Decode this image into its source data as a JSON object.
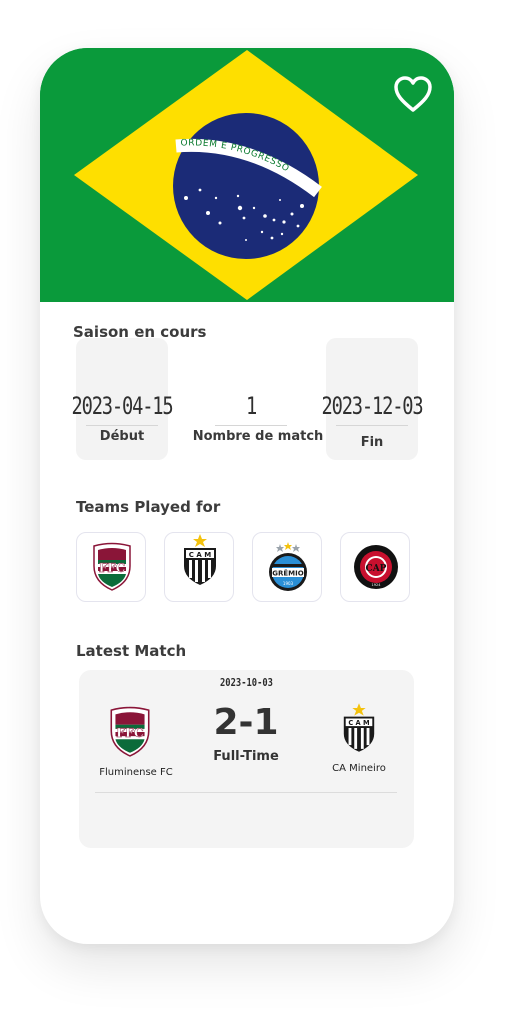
{
  "header": {
    "flag": {
      "motto": "ORDEM E PROGRESSO",
      "colors": {
        "green": "#0a9a3b",
        "yellow": "#fedf00",
        "blue": "#1b2b77",
        "white": "#ffffff"
      }
    },
    "favorite_icon": "heart-outline-icon"
  },
  "season": {
    "title": "Saison en cours",
    "start": {
      "value": "2023-04-15",
      "label": "Début"
    },
    "matches": {
      "value": "1",
      "label": "Nombre de match"
    },
    "end": {
      "value": "2023-12-03",
      "label": "Fin"
    }
  },
  "teams": {
    "title": "Teams Played for",
    "items": [
      {
        "icon": "fluminense-crest-icon",
        "letters": "FFC"
      },
      {
        "icon": "atletico-mineiro-crest-icon",
        "letters": "CAM"
      },
      {
        "icon": "gremio-crest-icon",
        "letters": "GRÊMIO"
      },
      {
        "icon": "athletico-paranaense-crest-icon",
        "letters": "CAP"
      }
    ]
  },
  "latest_match": {
    "title": "Latest Match",
    "date": "2023-10-03",
    "score": "2-1",
    "status": "Full-Time",
    "home_team": "Fluminense FC",
    "away_team": "CA Mineiro"
  },
  "colors": {
    "accent_star": "#f4c20d",
    "card_bg": "#f3f3f3"
  }
}
